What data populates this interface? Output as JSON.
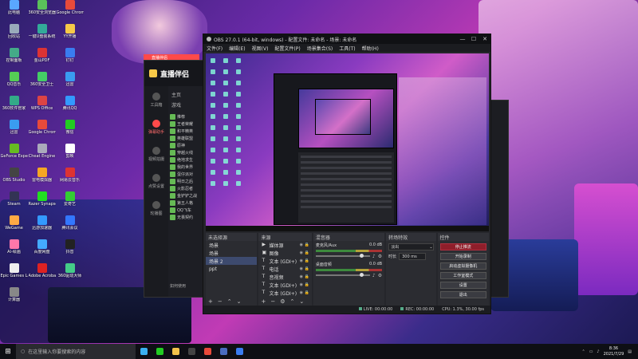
{
  "desktop": {
    "icons": [
      {
        "label": "此电脑",
        "color": "#5aa7ff"
      },
      {
        "label": "360安全浏览器",
        "color": "#5ac05a"
      },
      {
        "label": "Google Chrome",
        "color": "#e84a3a"
      },
      {
        "label": "回收站",
        "color": "#9ab"
      },
      {
        "label": "一键U盘装系统",
        "color": "#3a9"
      },
      {
        "label": "YY开播",
        "color": "#f7c948"
      },
      {
        "label": "控制面板",
        "color": "#4a8"
      },
      {
        "label": "金山PDF",
        "color": "#d33"
      },
      {
        "label": "钉钉",
        "color": "#3a7cf0"
      },
      {
        "label": "QQ音乐",
        "color": "#5c5"
      },
      {
        "label": "360安全卫士",
        "color": "#4c6"
      },
      {
        "label": "迅雷",
        "color": "#3a9cf0"
      },
      {
        "label": "360软件管家",
        "color": "#3a8"
      },
      {
        "label": "WPS Office",
        "color": "#d44"
      },
      {
        "label": "腾讯QQ",
        "color": "#39f"
      },
      {
        "label": "迅雷",
        "color": "#3a9cf0"
      },
      {
        "label": "Google Chrome",
        "color": "#e84a3a"
      },
      {
        "label": "微信",
        "color": "#2c2"
      },
      {
        "label": "GeForce Experience",
        "color": "#6b2"
      },
      {
        "label": "Cheat Engine",
        "color": "#aab"
      },
      {
        "label": "剪映",
        "color": "#fff"
      },
      {
        "label": "OBS Studio",
        "color": "#444"
      },
      {
        "label": "雷电模拟器",
        "color": "#f5a623"
      },
      {
        "label": "网易云音乐",
        "color": "#d33"
      },
      {
        "label": "Steam",
        "color": "#335"
      },
      {
        "label": "Razer Synapse",
        "color": "#2d2"
      },
      {
        "label": "爱奇艺",
        "color": "#3c3"
      },
      {
        "label": "WeGame",
        "color": "#fa4"
      },
      {
        "label": "迅游加速器",
        "color": "#39f"
      },
      {
        "label": "腾讯会议",
        "color": "#37f"
      },
      {
        "label": "AI-绘画",
        "color": "#f7a"
      },
      {
        "label": "百度网盘",
        "color": "#4af"
      },
      {
        "label": "抖音",
        "color": "#222"
      },
      {
        "label": "Epic Games Launcher",
        "color": "#eee"
      },
      {
        "label": "Adobe Acrobat",
        "color": "#d22"
      },
      {
        "label": "360驱动大师",
        "color": "#4c8"
      },
      {
        "label": "计算器",
        "color": "#888"
      }
    ]
  },
  "helper_app": {
    "title": "直播伴侣",
    "top_label": "直播伴侣",
    "nav": [
      {
        "label": "工具箱",
        "active": false
      },
      {
        "label": "弹幕助手",
        "active": true
      },
      {
        "label": "视频拍摄",
        "active": false
      },
      {
        "label": "点赞设置",
        "active": false
      },
      {
        "label": "轮播图",
        "active": false
      }
    ],
    "tabs": [
      "主页",
      "游戏"
    ],
    "list": [
      "推荐",
      "王者荣耀",
      "和平精英",
      "英雄联盟",
      "原神",
      "穿越火线",
      "绝地求生",
      "我的世界",
      "蛋仔派对",
      "明日之后",
      "火影忍者",
      "金铲铲之战",
      "第五人格",
      "QQ飞车",
      "无畏契约"
    ],
    "bottom_label": "如何使用"
  },
  "obs": {
    "title": "OBS 27.0.1 (64-bit, windows) - 配置文件: 未命名 - 场景: 未命名",
    "menu": [
      "文件(F)",
      "编辑(E)",
      "视图(V)",
      "配置文件(P)",
      "场景集合(S)",
      "工具(T)",
      "帮助(H)"
    ],
    "docks": {
      "scenes": {
        "title": "场景",
        "top_label": "未选择源",
        "items": [
          {
            "label": "场景",
            "selected": false
          },
          {
            "label": "场景 2",
            "selected": true
          },
          {
            "label": "ppt",
            "selected": false
          }
        ]
      },
      "sources": {
        "title": "来源",
        "items": [
          {
            "label": "媒体源",
            "icon": "media-icon"
          },
          {
            "label": "图像",
            "icon": "image-icon"
          },
          {
            "label": "文本 (GDI+)",
            "icon": "text-icon"
          },
          {
            "label": "电话",
            "icon": "text-icon"
          },
          {
            "label": "音视频",
            "icon": "text-icon"
          },
          {
            "label": "文本 (GDI+)",
            "icon": "text-icon"
          },
          {
            "label": "文本 (GDI+)",
            "icon": "text-icon"
          }
        ]
      },
      "mixer": {
        "title": "混音器",
        "channels": [
          {
            "name": "麦克风/Aux",
            "db": "0.0 dB",
            "level": 0.85
          },
          {
            "name": "桌面音频",
            "db": "0.0 dB",
            "level": 0.85
          }
        ]
      },
      "transitions": {
        "title": "转场特效",
        "type": "淡出",
        "duration_label": "时长",
        "duration": "300 ms"
      },
      "controls": {
        "title": "控件",
        "buttons": [
          "停止推流",
          "开始录制",
          "启动虚拟摄像机",
          "工作室模式",
          "设置",
          "退出"
        ]
      }
    },
    "status": {
      "live": "LIVE: 00:00:00",
      "rec": "REC: 00:00:00",
      "cpu": "CPU: 1.3%, 30.00 fps"
    }
  },
  "taskbar": {
    "search_placeholder": "在这里输入你要搜索的内容",
    "apps": [
      {
        "name": "edge",
        "color": "#3ab0f0"
      },
      {
        "name": "wechat",
        "color": "#2c2"
      },
      {
        "name": "file-explorer",
        "color": "#f3c34a"
      },
      {
        "name": "obs",
        "color": "#444"
      },
      {
        "name": "chrome",
        "color": "#e84a3a"
      },
      {
        "name": "steam",
        "color": "#4a6cc0"
      },
      {
        "name": "app",
        "color": "#3a7cf0"
      }
    ],
    "time": "8:36",
    "date": "2021/7/29"
  }
}
